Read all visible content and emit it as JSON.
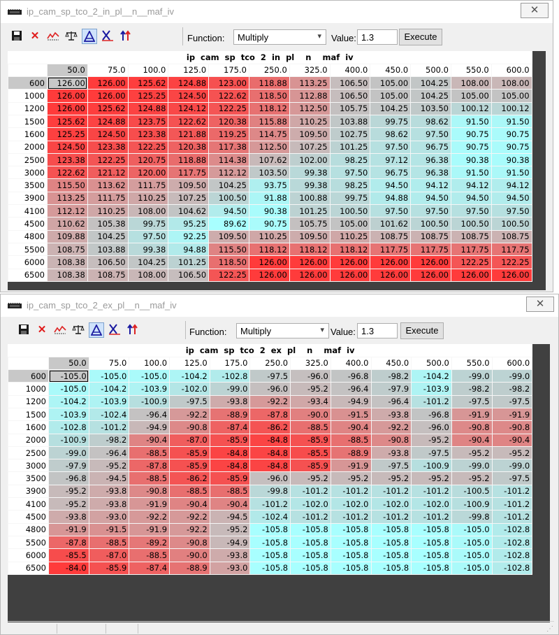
{
  "toolbar": {
    "function_label": "Function:",
    "function_value": "Multiply",
    "value_label": "Value:",
    "value": "1.3",
    "execute_label": "Execute",
    "icons": [
      "save-icon",
      "delete-icon",
      "graph-icon",
      "balance-icon",
      "interpolate-icon",
      "axis-icon",
      "arrows-icon"
    ]
  },
  "colors": {
    "hot": "#ff3b3b",
    "cold": "#a8ffff",
    "neutral": "#c8b8b8",
    "selection": "#c8c8c8"
  },
  "windows": [
    {
      "title": "ip_cam_sp_tco_2_in_pl__n__maf_iv",
      "table_name": "ip  cam  sp  tco  2  in  pl    n    maf  iv",
      "columns": [
        "50.0",
        "75.0",
        "100.0",
        "125.0",
        "175.0",
        "250.0",
        "325.0",
        "400.0",
        "450.0",
        "500.0",
        "550.0",
        "600.0"
      ],
      "rows": [
        "600",
        "1000",
        "1200",
        "1500",
        "1600",
        "2000",
        "2500",
        "3000",
        "3500",
        "3900",
        "4100",
        "4500",
        "4800",
        "5500",
        "6000",
        "6500"
      ],
      "values": [
        [
          "126.00",
          "126.00",
          "125.62",
          "124.88",
          "123.00",
          "118.88",
          "113.25",
          "106.50",
          "105.00",
          "104.25",
          "108.00",
          "108.00"
        ],
        [
          "126.00",
          "126.00",
          "125.25",
          "124.50",
          "122.62",
          "118.50",
          "112.88",
          "106.50",
          "105.00",
          "104.25",
          "105.00",
          "105.00"
        ],
        [
          "126.00",
          "125.62",
          "124.88",
          "124.12",
          "122.25",
          "118.12",
          "112.50",
          "105.75",
          "104.25",
          "103.50",
          "100.12",
          "100.12"
        ],
        [
          "125.62",
          "124.88",
          "123.75",
          "122.62",
          "120.38",
          "115.88",
          "110.25",
          "103.88",
          "99.75",
          "98.62",
          "91.50",
          "91.50"
        ],
        [
          "125.25",
          "124.50",
          "123.38",
          "121.88",
          "119.25",
          "114.75",
          "109.50",
          "102.75",
          "98.62",
          "97.50",
          "90.75",
          "90.75"
        ],
        [
          "124.50",
          "123.38",
          "122.25",
          "120.38",
          "117.38",
          "112.50",
          "107.25",
          "101.25",
          "97.50",
          "96.75",
          "90.75",
          "90.75"
        ],
        [
          "123.38",
          "122.25",
          "120.75",
          "118.88",
          "114.38",
          "107.62",
          "102.00",
          "98.25",
          "97.12",
          "96.38",
          "90.38",
          "90.38"
        ],
        [
          "122.62",
          "121.12",
          "120.00",
          "117.75",
          "112.12",
          "103.50",
          "99.38",
          "97.50",
          "96.75",
          "96.38",
          "91.50",
          "91.50"
        ],
        [
          "115.50",
          "113.62",
          "111.75",
          "109.50",
          "104.25",
          "93.75",
          "99.38",
          "98.25",
          "94.50",
          "94.12",
          "94.12",
          "94.12"
        ],
        [
          "113.25",
          "111.75",
          "110.25",
          "107.25",
          "100.50",
          "91.88",
          "100.88",
          "99.75",
          "94.88",
          "94.50",
          "94.50",
          "94.50"
        ],
        [
          "112.12",
          "110.25",
          "108.00",
          "104.62",
          "94.50",
          "90.38",
          "101.25",
          "100.50",
          "97.50",
          "97.50",
          "97.50",
          "97.50"
        ],
        [
          "110.62",
          "105.38",
          "99.75",
          "95.25",
          "89.62",
          "90.75",
          "105.75",
          "105.00",
          "101.62",
          "100.50",
          "100.50",
          "100.50"
        ],
        [
          "109.88",
          "104.25",
          "97.50",
          "92.25",
          "109.50",
          "110.25",
          "109.50",
          "110.25",
          "108.75",
          "108.75",
          "108.75",
          "108.75"
        ],
        [
          "108.75",
          "103.88",
          "99.38",
          "94.88",
          "115.50",
          "118.12",
          "118.12",
          "118.12",
          "117.75",
          "117.75",
          "117.75",
          "117.75"
        ],
        [
          "108.38",
          "106.50",
          "104.25",
          "101.25",
          "118.50",
          "126.00",
          "126.00",
          "126.00",
          "126.00",
          "126.00",
          "122.25",
          "122.25"
        ],
        [
          "108.38",
          "108.75",
          "108.00",
          "106.50",
          "122.25",
          "126.00",
          "126.00",
          "126.00",
          "126.00",
          "126.00",
          "126.00",
          "126.00"
        ]
      ]
    },
    {
      "title": "ip_cam_sp_tco_2_ex_pl__n__maf_iv",
      "table_name": "ip  cam  sp  tco  2  ex  pl    n    maf  iv",
      "columns": [
        "50.0",
        "75.0",
        "100.0",
        "125.0",
        "175.0",
        "250.0",
        "325.0",
        "400.0",
        "450.0",
        "500.0",
        "550.0",
        "600.0"
      ],
      "rows": [
        "600",
        "1000",
        "1200",
        "1500",
        "1600",
        "2000",
        "2500",
        "3000",
        "3500",
        "3900",
        "4100",
        "4500",
        "4800",
        "5500",
        "6000",
        "6500"
      ],
      "values": [
        [
          "-105.0",
          "-105.0",
          "-105.0",
          "-104.2",
          "-102.8",
          "-97.5",
          "-96.0",
          "-96.8",
          "-98.2",
          "-104.2",
          "-99.0",
          "-99.0"
        ],
        [
          "-105.0",
          "-104.2",
          "-103.9",
          "-102.0",
          "-99.0",
          "-96.0",
          "-95.2",
          "-96.4",
          "-97.9",
          "-103.9",
          "-98.2",
          "-98.2"
        ],
        [
          "-104.2",
          "-103.9",
          "-100.9",
          "-97.5",
          "-93.8",
          "-92.2",
          "-93.4",
          "-94.9",
          "-96.4",
          "-101.2",
          "-97.5",
          "-97.5"
        ],
        [
          "-103.9",
          "-102.4",
          "-96.4",
          "-92.2",
          "-88.9",
          "-87.8",
          "-90.0",
          "-91.5",
          "-93.8",
          "-96.8",
          "-91.9",
          "-91.9"
        ],
        [
          "-102.8",
          "-101.2",
          "-94.9",
          "-90.8",
          "-87.4",
          "-86.2",
          "-88.5",
          "-90.4",
          "-92.2",
          "-96.0",
          "-90.8",
          "-90.8"
        ],
        [
          "-100.9",
          "-98.2",
          "-90.4",
          "-87.0",
          "-85.9",
          "-84.8",
          "-85.9",
          "-88.5",
          "-90.8",
          "-95.2",
          "-90.4",
          "-90.4"
        ],
        [
          "-99.0",
          "-96.4",
          "-88.5",
          "-85.9",
          "-84.8",
          "-84.8",
          "-85.5",
          "-88.9",
          "-93.8",
          "-97.5",
          "-95.2",
          "-95.2"
        ],
        [
          "-97.9",
          "-95.2",
          "-87.8",
          "-85.9",
          "-84.8",
          "-84.8",
          "-85.9",
          "-91.9",
          "-97.5",
          "-100.9",
          "-99.0",
          "-99.0"
        ],
        [
          "-96.8",
          "-94.5",
          "-88.5",
          "-86.2",
          "-85.9",
          "-96.0",
          "-95.2",
          "-95.2",
          "-95.2",
          "-95.2",
          "-95.2",
          "-97.5"
        ],
        [
          "-95.2",
          "-93.8",
          "-90.8",
          "-88.5",
          "-88.5",
          "-99.8",
          "-101.2",
          "-101.2",
          "-101.2",
          "-101.2",
          "-100.5",
          "-101.2"
        ],
        [
          "-95.2",
          "-93.8",
          "-91.9",
          "-90.4",
          "-90.4",
          "-101.2",
          "-102.0",
          "-102.0",
          "-102.0",
          "-102.0",
          "-100.9",
          "-101.2"
        ],
        [
          "-93.8",
          "-93.0",
          "-92.2",
          "-92.2",
          "-94.5",
          "-102.4",
          "-101.2",
          "-101.2",
          "-101.2",
          "-101.2",
          "-99.8",
          "-101.2"
        ],
        [
          "-91.9",
          "-91.5",
          "-91.9",
          "-92.2",
          "-95.2",
          "-105.8",
          "-105.8",
          "-105.8",
          "-105.8",
          "-105.8",
          "-105.0",
          "-102.8"
        ],
        [
          "-87.8",
          "-88.5",
          "-89.2",
          "-90.8",
          "-94.9",
          "-105.8",
          "-105.8",
          "-105.8",
          "-105.8",
          "-105.8",
          "-105.0",
          "-102.8"
        ],
        [
          "-85.5",
          "-87.0",
          "-88.5",
          "-90.0",
          "-93.8",
          "-105.8",
          "-105.8",
          "-105.8",
          "-105.8",
          "-105.8",
          "-105.0",
          "-102.8"
        ],
        [
          "-84.0",
          "-85.9",
          "-87.4",
          "-88.9",
          "-93.0",
          "-105.8",
          "-105.8",
          "-105.8",
          "-105.8",
          "-105.8",
          "-105.0",
          "-102.8"
        ]
      ]
    }
  ]
}
